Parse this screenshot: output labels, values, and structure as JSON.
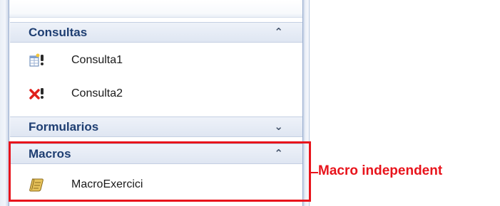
{
  "groups": {
    "consultas": {
      "title": "Consultas",
      "collapse_icon": "chevron-double-up-icon",
      "items": [
        {
          "label": "Consulta1",
          "icon": "query-wizard-icon"
        },
        {
          "label": "Consulta2",
          "icon": "delete-query-icon"
        }
      ]
    },
    "formularios": {
      "title": "Formularios",
      "expand_icon": "chevron-double-down-icon"
    },
    "macros": {
      "title": "Macros",
      "collapse_icon": "chevron-double-up-icon",
      "items": [
        {
          "label": "MacroExercici",
          "icon": "macro-scroll-icon"
        }
      ]
    }
  },
  "annotation": {
    "text": "Macro independent",
    "color": "#e8141c"
  },
  "colors": {
    "header_text": "#1e3e72",
    "header_bg": "#dfe6f2",
    "highlight": "#e8141c"
  }
}
